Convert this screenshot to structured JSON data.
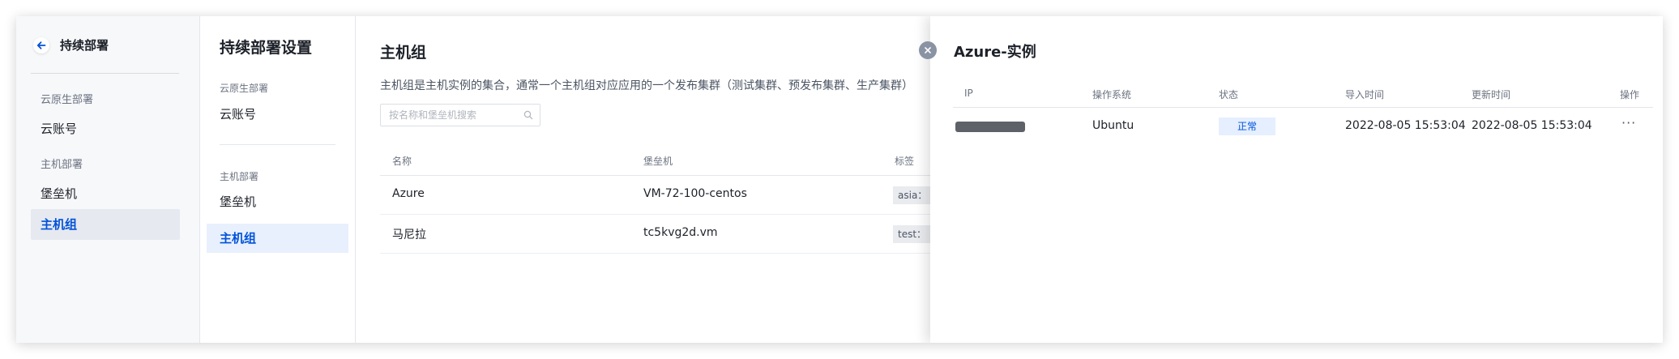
{
  "leftnav": {
    "title": "持续部署",
    "groups": [
      {
        "label": "云原生部署",
        "items": [
          {
            "label": "云账号"
          }
        ]
      },
      {
        "label": "主机部署",
        "items": [
          {
            "label": "堡垒机"
          },
          {
            "label": "主机组",
            "active": true
          }
        ]
      }
    ]
  },
  "settings": {
    "title": "持续部署设置",
    "groups": [
      {
        "label": "云原生部署",
        "items": [
          {
            "label": "云账号"
          }
        ]
      },
      {
        "label": "主机部署",
        "items": [
          {
            "label": "堡垒机"
          },
          {
            "label": "主机组",
            "active": true
          }
        ]
      }
    ]
  },
  "main": {
    "title": "主机组",
    "description": "主机组是主机实例的集合，通常一个主机组对应应用的一个发布集群（测试集群、预发布集群、生产集群）",
    "search": {
      "placeholder": "按名称和堡垒机搜索",
      "value": ""
    },
    "columns": [
      "名称",
      "堡垒机",
      "标签"
    ],
    "rows": [
      {
        "name": "Azure",
        "bastion": "VM-72-100-centos",
        "tag": "asia："
      },
      {
        "name": "马尼拉",
        "bastion": "tc5kvg2d.vm",
        "tag": "test："
      }
    ]
  },
  "drawer": {
    "title": "Azure-实例",
    "columns": [
      "IP",
      "操作系统",
      "状态",
      "导入时间",
      "更新时间",
      "操作"
    ],
    "rows": [
      {
        "ip": "",
        "os": "Ubuntu",
        "status": "正常",
        "imported": "2022-08-05 15:53:04",
        "updated": "2022-08-05 15:53:04",
        "action": "···"
      }
    ]
  },
  "colors": {
    "accent": "#0052d9",
    "active_bg": "#e8f0fe",
    "status_bg": "#e5efff",
    "close_btn": "#8a93a3"
  },
  "icons": {
    "back": "arrow-left-icon",
    "close": "close-icon",
    "search": "search-icon",
    "more": "ellipsis-icon"
  }
}
